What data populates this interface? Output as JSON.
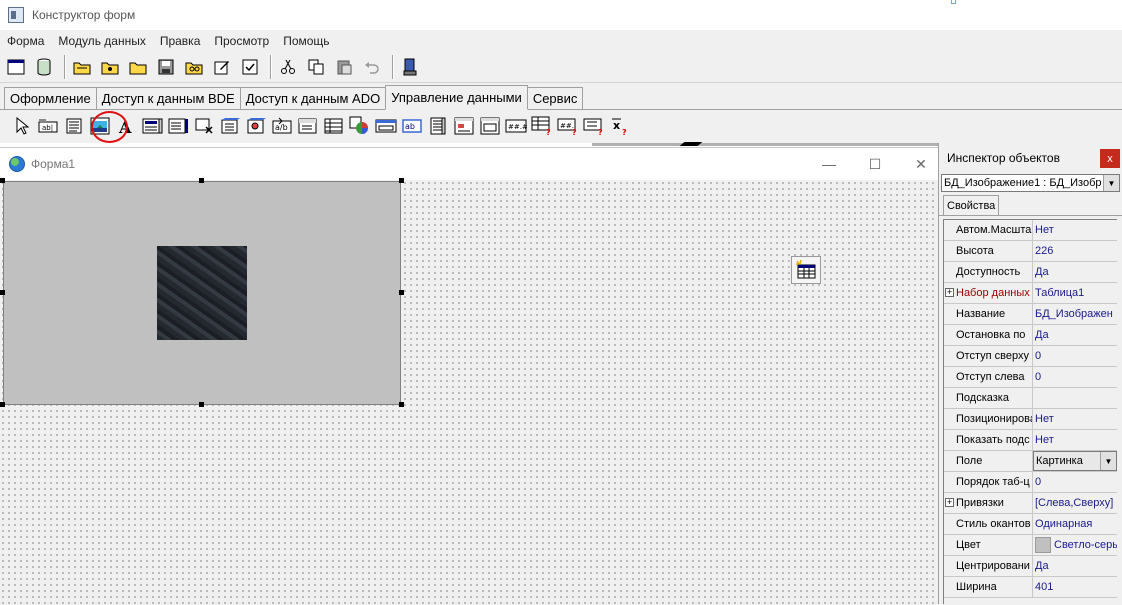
{
  "window": {
    "title": "Конструктор форм"
  },
  "menu": [
    "Форма",
    "Модуль данных",
    "Правка",
    "Просмотр",
    "Помощь"
  ],
  "toolbar": {
    "icons": [
      "new-form-icon",
      "database-icon",
      "open-folder-icon",
      "open-folder-icon-2",
      "folder-icon",
      "save-icon",
      "save-all-icon",
      "edit-icon",
      "checklist-icon",
      "cut-icon",
      "copy-icon",
      "paste-icon",
      "undo-icon",
      "run-icon"
    ]
  },
  "tabs": {
    "items": [
      "Оформление",
      "Доступ к данным BDE",
      "Доступ к данным ADO",
      "Управление данными",
      "Сервис"
    ],
    "active_index": 3
  },
  "palette": {
    "icons": [
      "pointer-icon",
      "db-edit-icon",
      "db-memo-icon",
      "db-image-icon",
      "db-label-icon",
      "db-listbox-icon",
      "db-combobox-icon",
      "db-checkbox-icon",
      "db-radio-icon",
      "db-lookup-list-icon",
      "db-lookup-combo-icon",
      "db-richedit-icon",
      "db-ctrlgrid-icon",
      "db-chart-icon",
      "db-grid-icon",
      "db-navigator-icon",
      "db-text-icon",
      "db-memo2-icon",
      "db-group-icon",
      "db-edit2-icon",
      "db-grid2-icon",
      "db-query-icon",
      "db-sum-icon",
      "db-remove-icon"
    ],
    "highlighted_index": 3
  },
  "form": {
    "title": "Форма1",
    "controls": {
      "minimize": "—",
      "maximize": "☐",
      "close": "✕"
    }
  },
  "inspector": {
    "title": "Инспектор объектов",
    "close_label": "x",
    "selected_object": "БД_Изображение1 : БД_Изобр",
    "tab": "Свойства",
    "properties": [
      {
        "name": "Автом.Масшта",
        "value": "Нет"
      },
      {
        "name": "Высота",
        "value": "226"
      },
      {
        "name": "Доступность",
        "value": "Да"
      },
      {
        "name": "Набор данных",
        "value": "Таблица1",
        "expandable": true,
        "red": true
      },
      {
        "name": "Название",
        "value": "БД_Изображен"
      },
      {
        "name": "Остановка по ",
        "value": "Да"
      },
      {
        "name": "Отступ сверху",
        "value": "0"
      },
      {
        "name": "Отступ слева",
        "value": "0"
      },
      {
        "name": "Подсказка",
        "value": ""
      },
      {
        "name": "Позиционирова",
        "value": "Нет"
      },
      {
        "name": "Показать подс",
        "value": "Нет"
      },
      {
        "name": "Поле",
        "value": "Картинка",
        "combo": true
      },
      {
        "name": "Порядок таб-ц",
        "value": "0"
      },
      {
        "name": "Привязки",
        "value": "[Слева,Сверху]",
        "expandable": true
      },
      {
        "name": "Стиль окантов",
        "value": "Одинарная"
      },
      {
        "name": "Цвет",
        "value": "Светло-серы",
        "swatch": "#c0c0c0"
      },
      {
        "name": "Центрировани",
        "value": "Да"
      },
      {
        "name": "Ширина",
        "value": "401"
      }
    ]
  },
  "colors": {
    "highlight_circle": "#e01010",
    "inspector_close": "#c42b1c",
    "property_value": "#1a1a8c",
    "property_name_red": "#a00000"
  }
}
